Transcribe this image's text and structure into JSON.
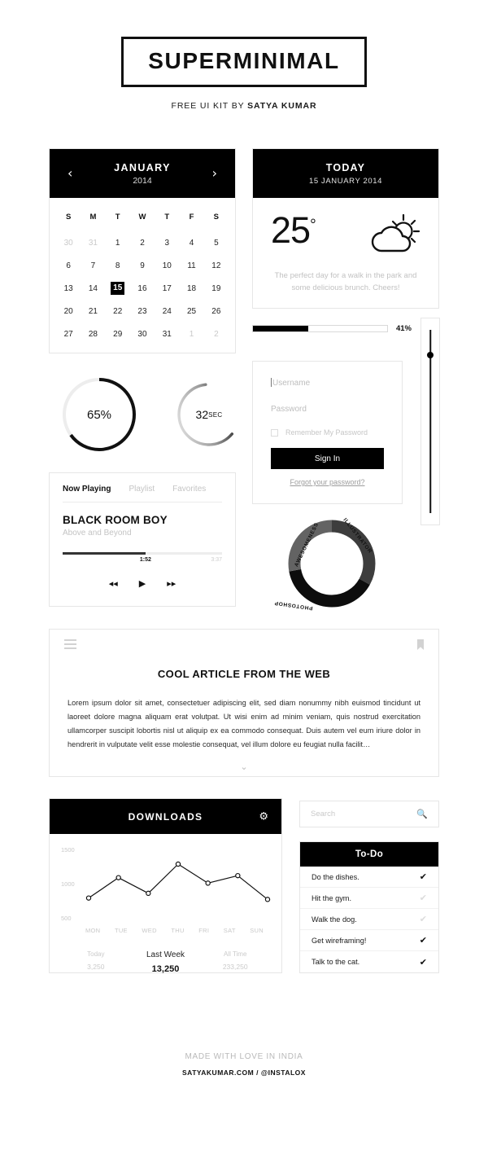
{
  "masthead": {
    "logo": "SUPERMINIMAL",
    "tagline_prefix": "FREE UI KIT BY ",
    "tagline_author": "SATYA KUMAR"
  },
  "calendar": {
    "month": "JANUARY",
    "year": "2014",
    "prev_icon": "‹",
    "next_icon": "›",
    "dow": [
      "S",
      "M",
      "T",
      "W",
      "T",
      "F",
      "S"
    ],
    "days": [
      {
        "n": "30",
        "muted": true
      },
      {
        "n": "31",
        "muted": true
      },
      {
        "n": "1"
      },
      {
        "n": "2"
      },
      {
        "n": "3"
      },
      {
        "n": "4"
      },
      {
        "n": "5"
      },
      {
        "n": "6"
      },
      {
        "n": "7"
      },
      {
        "n": "8"
      },
      {
        "n": "9"
      },
      {
        "n": "10"
      },
      {
        "n": "11"
      },
      {
        "n": "12"
      },
      {
        "n": "13"
      },
      {
        "n": "14"
      },
      {
        "n": "15",
        "today": true
      },
      {
        "n": "16"
      },
      {
        "n": "17"
      },
      {
        "n": "18"
      },
      {
        "n": "19"
      },
      {
        "n": "20"
      },
      {
        "n": "21"
      },
      {
        "n": "22"
      },
      {
        "n": "23"
      },
      {
        "n": "24"
      },
      {
        "n": "25"
      },
      {
        "n": "26"
      },
      {
        "n": "27"
      },
      {
        "n": "28"
      },
      {
        "n": "29"
      },
      {
        "n": "30"
      },
      {
        "n": "31"
      },
      {
        "n": "1",
        "muted": true
      },
      {
        "n": "2",
        "muted": true
      }
    ]
  },
  "weather": {
    "title": "TODAY",
    "date": "15 JANUARY 2014",
    "temperature": "25",
    "degree": "°",
    "icon": "sun-behind-cloud-icon",
    "description": "The perfect day for a walk in the park and some delicious brunch. Cheers!"
  },
  "progress_bar": {
    "percent": 41,
    "label": "41%"
  },
  "vertical_slider": {
    "value_pct": 12
  },
  "rings": [
    {
      "label": "65%",
      "value": 65,
      "suffix": ""
    },
    {
      "label": "32",
      "value": 62,
      "suffix": "SEC"
    }
  ],
  "player": {
    "tabs": [
      {
        "label": "Now Playing",
        "active": true
      },
      {
        "label": "Playlist",
        "active": false
      },
      {
        "label": "Favorites",
        "active": false
      }
    ],
    "track_title": "BLACK ROOM BOY",
    "artist": "Above and Beyond",
    "current_time": "1:52",
    "duration": "3:37",
    "progress_pct": 52,
    "prev_icon": "◂◂",
    "play_icon": "▶",
    "next_icon": "▸▸"
  },
  "login": {
    "username_placeholder": "Username",
    "password_placeholder": "Password",
    "remember_label": "Remember My Password",
    "remember_checked": false,
    "signin_label": "Sign In",
    "forgot_label": "Forgot your password?"
  },
  "donut": {
    "segments": [
      {
        "label": "ILLUSTRATOR",
        "value": 33,
        "color": "#3d3d3d"
      },
      {
        "label": "PHOTOSHOP",
        "value": 39,
        "color": "#0d0d0d"
      },
      {
        "label": "AWESOMENESS",
        "value": 28,
        "color": "#636363"
      }
    ]
  },
  "article": {
    "menu_icon": "hamburger-icon",
    "bookmark_icon": "bookmark-icon",
    "title": "COOL ARTICLE FROM THE WEB",
    "body": "Lorem ipsum dolor sit amet, consectetuer adipiscing elit, sed diam nonummy nibh euismod tincidunt ut laoreet dolore magna aliquam erat volutpat. Ut wisi enim ad minim veniam, quis nostrud exercitation ullamcorper suscipit lobortis nisl ut aliquip ex ea commodo consequat. Duis autem vel eum iriure dolor in hendrerit in vulputate velit esse molestie consequat, vel illum dolore eu feugiat nulla facilit…",
    "expand_icon": "⌄"
  },
  "downloads": {
    "title": "DOWNLOADS",
    "gear_icon": "⚙",
    "stats": [
      {
        "label": "Today",
        "value": "3,250",
        "emphasis": false
      },
      {
        "label": "Last Week",
        "value": "13,250",
        "emphasis": true
      },
      {
        "label": "All Time",
        "value": "233,250",
        "emphasis": false
      }
    ]
  },
  "chart_data": {
    "type": "line",
    "title": "DOWNLOADS",
    "categories": [
      "MON",
      "TUE",
      "WED",
      "THU",
      "FRI",
      "SAT",
      "SUN"
    ],
    "values": [
      800,
      1100,
      870,
      1300,
      1020,
      1130,
      780
    ],
    "yticks": [
      1500,
      1000,
      500
    ],
    "ylim": [
      400,
      1600
    ],
    "xlabel": "",
    "ylabel": "",
    "grid": false,
    "legend": "none",
    "marker": "circle-open",
    "line_color": "#111111"
  },
  "search": {
    "placeholder": "Search",
    "icon": "🔍"
  },
  "todo": {
    "title": "To-Do",
    "check_icon": "✔",
    "items": [
      {
        "text": "Do the dishes.",
        "done": true
      },
      {
        "text": "Hit the gym.",
        "done": false
      },
      {
        "text": "Walk the dog.",
        "done": false
      },
      {
        "text": "Get wireframing!",
        "done": true
      },
      {
        "text": "Talk to the cat.",
        "done": true
      }
    ]
  },
  "footer": {
    "line1": "MADE WITH LOVE IN INDIA",
    "line2": "SATYAKUMAR.COM / @INSTALOX"
  }
}
